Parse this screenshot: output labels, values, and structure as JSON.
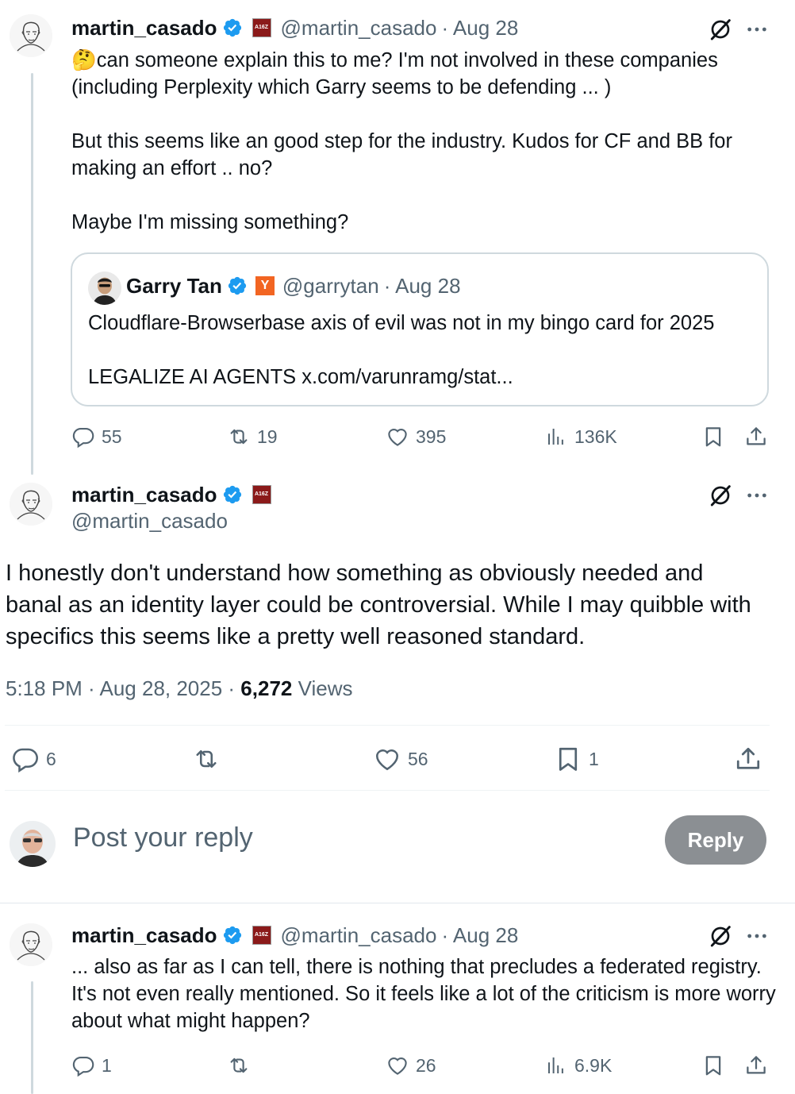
{
  "colors": {
    "verified": "#1d9bf0",
    "text": "#0f1419",
    "muted": "#536471",
    "border": "#cfd9de",
    "reply_button": "#8b8f93",
    "ycomb": "#f26522"
  },
  "post1": {
    "name": "martin_casado",
    "org_badge": "A16Z",
    "handle": "@martin_casado",
    "date": "· Aug 28",
    "emoji": "🤔",
    "text_line1": "can someone explain this to me? I'm not involved in these companies",
    "text_rest": "(including Perplexity which Garry seems to be defending ... )\n\nBut this seems like an good step for the industry. Kudos for CF and BB for making an effort .. no?\n\nMaybe I'm missing something?",
    "quote": {
      "name": "Garry Tan",
      "org_badge": "Y",
      "handle": "@garrytan",
      "date": "· Aug 28",
      "text": "Cloudflare-Browserbase axis of evil was not in my bingo card for 2025\n\nLEGALIZE AI AGENTS x.com/varunramg/stat..."
    },
    "actions": {
      "replies": "55",
      "reposts": "19",
      "likes": "395",
      "views": "136K"
    }
  },
  "main_post": {
    "name": "martin_casado",
    "org_badge": "A16Z",
    "handle": "@martin_casado",
    "text": "I honestly don't understand how something as obviously needed and banal as an identity layer could be controversial. While I may quibble with specifics this seems like a pretty well reasoned standard.",
    "timestamp": "5:18 PM · Aug 28, 2025 · ",
    "views_count": "6,272",
    "views_label": " Views",
    "actions": {
      "replies": "6",
      "likes": "56",
      "bookmarks": "1"
    }
  },
  "reply_box": {
    "placeholder": "Post your reply",
    "button": "Reply"
  },
  "post3": {
    "name": "martin_casado",
    "org_badge": "A16Z",
    "handle": "@martin_casado",
    "date": "· Aug 28",
    "text": "... also as far as I can tell, there is nothing that precludes a federated registry. It's not even really mentioned. So it feels like a lot of the criticism is more worry about what might happen?",
    "actions": {
      "replies": "1",
      "likes": "26",
      "views": "6.9K"
    }
  }
}
